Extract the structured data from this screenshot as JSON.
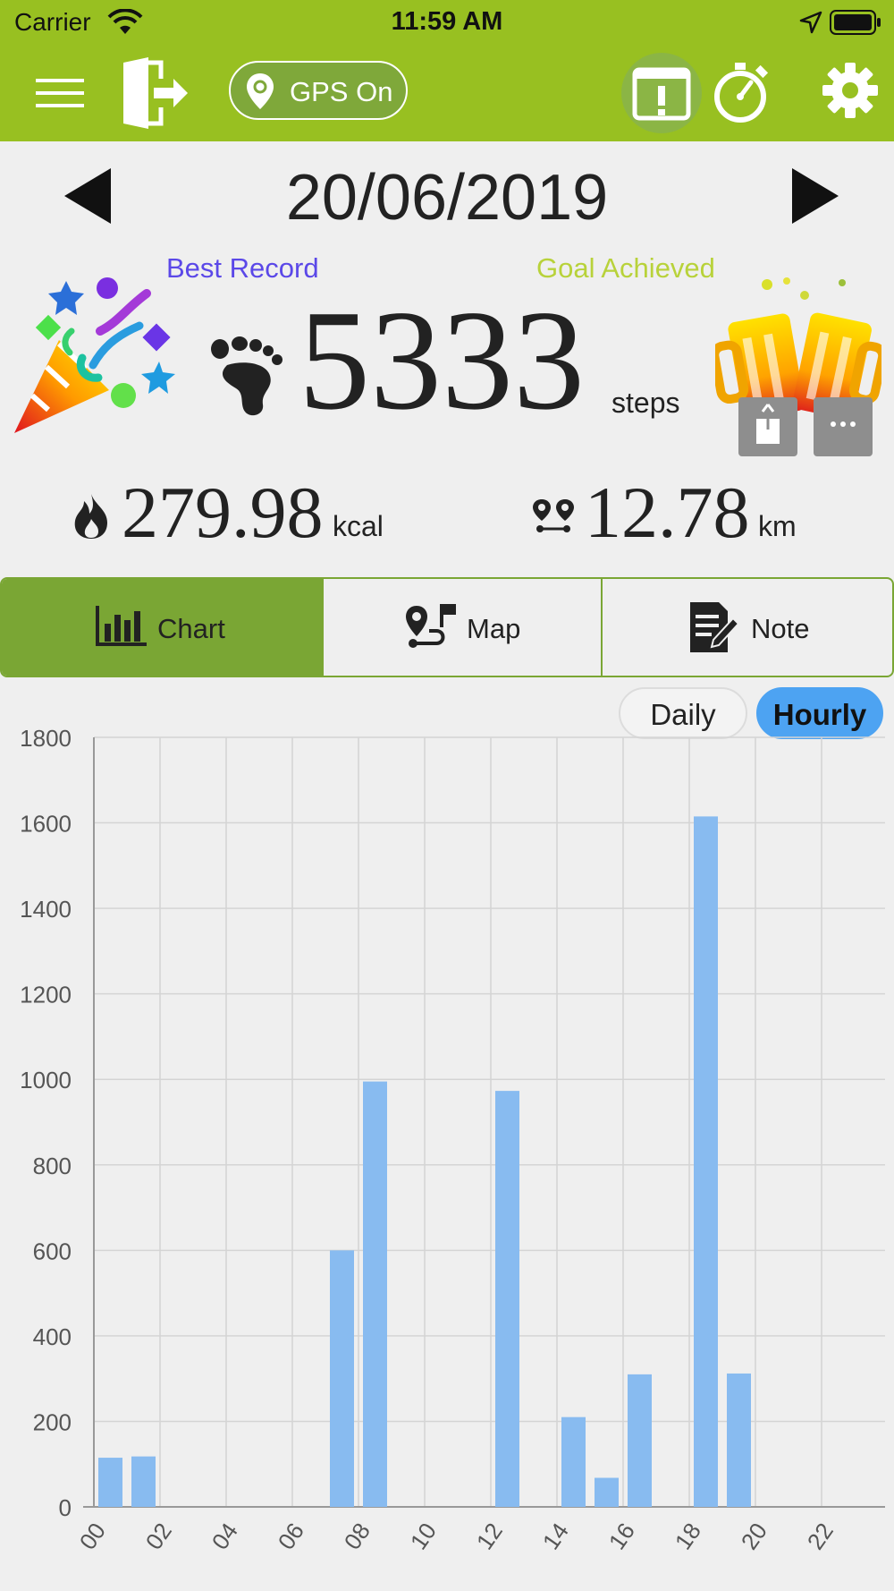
{
  "status_bar": {
    "carrier": "Carrier",
    "time": "11:59 AM"
  },
  "toolbar": {
    "gps_label": "GPS On"
  },
  "date": {
    "value": "20/06/2019"
  },
  "badges": {
    "best": "Best Record",
    "goal": "Goal Achieved"
  },
  "steps": {
    "value": "5333",
    "unit": "steps"
  },
  "calories": {
    "value": "279.98",
    "unit": "kcal"
  },
  "distance": {
    "value": "12.78",
    "unit": "km"
  },
  "tabs": [
    {
      "label": "Chart",
      "active": true
    },
    {
      "label": "Map",
      "active": false
    },
    {
      "label": "Note",
      "active": false
    }
  ],
  "segment": {
    "daily": "Daily",
    "hourly": "Hourly",
    "selected": "Hourly"
  },
  "colors": {
    "toolbar": "#98c021",
    "tab_active": "#7aa634",
    "bar": "#88bbf0",
    "segment_active": "#4da3f2",
    "best": "#5b48e8",
    "goal": "#b8d23a"
  },
  "chart_data": {
    "type": "bar",
    "x": [
      "00",
      "01",
      "02",
      "03",
      "04",
      "05",
      "06",
      "07",
      "08",
      "09",
      "10",
      "11",
      "12",
      "13",
      "14",
      "15",
      "16",
      "17",
      "18",
      "19",
      "20",
      "21",
      "22",
      "23"
    ],
    "values": [
      115,
      118,
      0,
      0,
      0,
      0,
      0,
      600,
      995,
      0,
      0,
      0,
      973,
      0,
      210,
      68,
      310,
      0,
      1615,
      312,
      0,
      0,
      0,
      0
    ],
    "x_tick_labels": [
      "00",
      "02",
      "04",
      "06",
      "08",
      "10",
      "12",
      "14",
      "16",
      "18",
      "20",
      "22"
    ],
    "y_tick_labels": [
      "0",
      "200",
      "400",
      "600",
      "800",
      "1000",
      "1200",
      "1400",
      "1600",
      "1800"
    ],
    "ylim": [
      0,
      1800
    ],
    "grid": true
  }
}
